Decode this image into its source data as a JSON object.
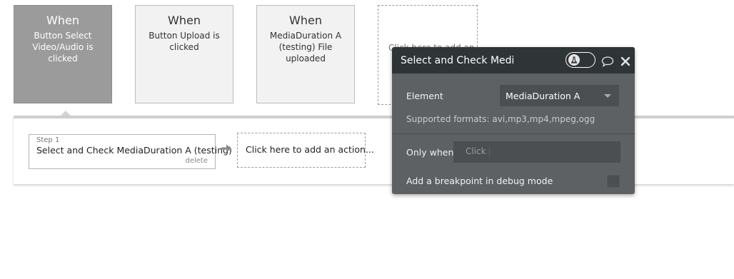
{
  "events": [
    {
      "when": "When",
      "description": "Button Select Video/Audio is clicked",
      "selected": true
    },
    {
      "when": "When",
      "description": "Button Upload is clicked",
      "selected": false
    },
    {
      "when": "When",
      "description": "MediaDuration A (testing) File uploaded",
      "selected": false
    }
  ],
  "add_event_label": "Click here to add an",
  "step": {
    "number_label": "Step 1",
    "title": "Select and Check MediaDuration A (testing)",
    "delete_label": "delete"
  },
  "add_action_label": "Click here to add an action...",
  "panel": {
    "title": "Select and Check MediaI",
    "element_label": "Element",
    "element_value": "MediaDuration A",
    "supported_formats": "Supported formats: avi,mp3,mp4,mpeg,ogg",
    "only_when_label": "Only when",
    "only_when_placeholder": "Click",
    "breakpoint_label": "Add a breakpoint in debug mode",
    "breakpoint_checked": false
  },
  "icons": {
    "toggle": "flask-toggle-icon",
    "comment": "comment-icon",
    "close": "close-icon",
    "arrow": "arrow-right-icon"
  },
  "colors": {
    "selected_card": "#9b9b9b",
    "card_bg": "#f1f2f1",
    "panel_bg": "#5d6163",
    "panel_header": "#2f3436"
  }
}
